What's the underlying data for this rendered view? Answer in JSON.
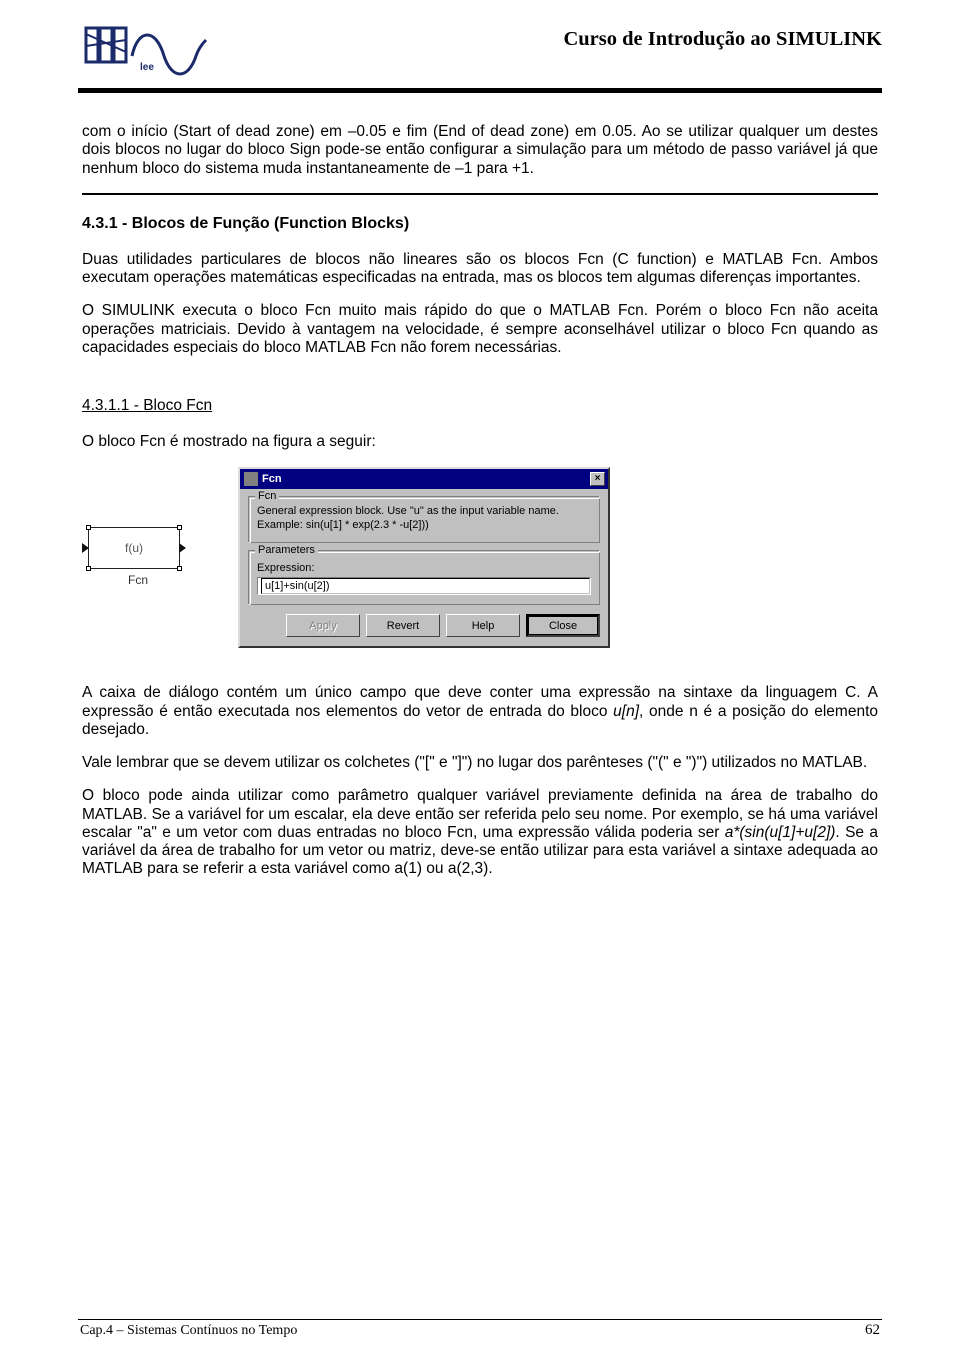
{
  "header": {
    "course_title": "Curso de Introdução ao SIMULINK"
  },
  "intro_para": "com o início (Start of dead zone) em –0.05 e fim (End of dead zone) em 0.05. Ao se utilizar qualquer um destes dois blocos no lugar do bloco Sign pode-se então configurar a simulação para um método de passo variável já que nenhum bloco do sistema muda instantaneamente de –1 para +1.",
  "section_431": {
    "heading": "4.3.1 - Blocos de Função (Function Blocks)",
    "p1": "Duas utilidades particulares de blocos não lineares são os blocos Fcn (C function) e MATLAB Fcn. Ambos executam operações matemáticas especificadas na entrada, mas os blocos tem algumas diferenças importantes.",
    "p2": "O SIMULINK executa o bloco Fcn muito mais rápido do que o MATLAB Fcn. Porém o bloco Fcn não aceita operações matriciais. Devido à vantagem na velocidade, é sempre aconselhável utilizar o bloco Fcn quando as capacidades especiais do bloco MATLAB Fcn não forem necessárias."
  },
  "section_4311": {
    "number": "4.3.1.1 - ",
    "title": "Bloco Fcn",
    "p1": "O bloco Fcn é mostrado na figura a seguir:"
  },
  "fcn_block": {
    "label": "f(u)",
    "caption": "Fcn"
  },
  "dialog": {
    "title": "Fcn",
    "close": "×",
    "group_fcn": {
      "legend": "Fcn",
      "desc": "General expression block. Use \"u\" as the input variable name.\nExample: sin(u[1] * exp(2.3 * -u[2]))"
    },
    "group_params": {
      "legend": "Parameters",
      "expr_label": "Expression:",
      "expr_value": "u[1]+sin(u[2])"
    },
    "buttons": {
      "apply": "Apply",
      "revert": "Revert",
      "help": "Help",
      "close": "Close"
    }
  },
  "after_figure": {
    "p1a": "A caixa de diálogo contém um único campo que deve conter uma expressão na sintaxe da linguagem C. A expressão é então executada nos elementos do vetor de entrada do bloco ",
    "p1_italic": "u[n]",
    "p1b": ", onde n é a posição do elemento desejado.",
    "p2": "Vale lembrar que se devem utilizar os colchetes (\"[\" e \"]\") no lugar dos parênteses (\"(\" e \")\") utilizados no MATLAB.",
    "p3a": "O bloco pode ainda utilizar como parâmetro qualquer variável previamente definida na área de trabalho do MATLAB. Se a variável for um escalar, ela deve então ser referida pelo seu nome. Por exemplo, se há uma variável escalar \"a\" e um vetor com duas entradas no bloco Fcn, uma expressão válida poderia ser ",
    "p3_italic": "a*(sin(u[1]+u[2])",
    "p3b": ". Se a variável da área de trabalho for um vetor ou matriz, deve-se então utilizar para esta variável a sintaxe adequada ao MATLAB para se referir a esta variável como a(1) ou a(2,3)."
  },
  "footer": {
    "chapter": "Cap.4 – Sistemas Contínuos no Tempo",
    "page": "62"
  }
}
